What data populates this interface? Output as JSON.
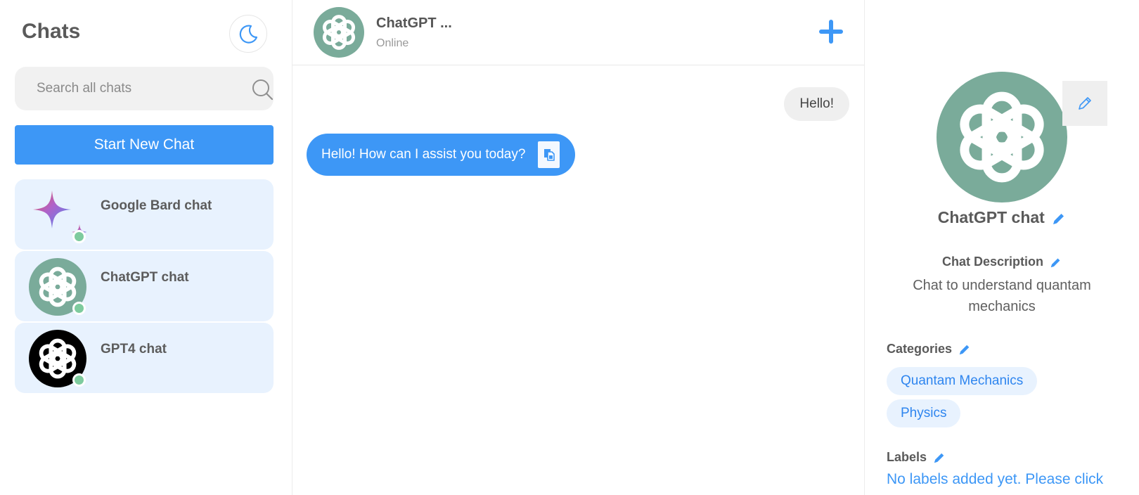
{
  "sidebar": {
    "title": "Chats",
    "theme_toggle_icon": "moon-icon",
    "search": {
      "placeholder": "Search all chats",
      "value": ""
    },
    "new_chat_label": "Start New Chat",
    "chats": [
      {
        "name": "Google Bard chat",
        "avatar": "bard-sparkle-icon",
        "status": "online"
      },
      {
        "name": "ChatGPT chat",
        "avatar": "openai-logo-green",
        "status": "online"
      },
      {
        "name": "GPT4 chat",
        "avatar": "openai-logo-black",
        "status": "online"
      }
    ]
  },
  "chat": {
    "header": {
      "name": "ChatGPT ...",
      "status": "Online",
      "action_icon": "plus-icon"
    },
    "messages": [
      {
        "role": "user",
        "text": "Hello!"
      },
      {
        "role": "assistant",
        "text": "Hello! How can I assist you today?"
      }
    ]
  },
  "details": {
    "name": "ChatGPT chat",
    "description_title": "Chat Description",
    "description": "Chat to understand quantam mechanics",
    "categories_title": "Categories",
    "categories": [
      "Quantam Mechanics",
      "Physics"
    ],
    "labels_title": "Labels",
    "labels_note": "No labels added yet. Please click"
  },
  "colors": {
    "accent": "#3d97f6",
    "chip_bg": "#e8f2fe",
    "online": "#7ecb9e",
    "openai_green": "#7aab9a"
  }
}
